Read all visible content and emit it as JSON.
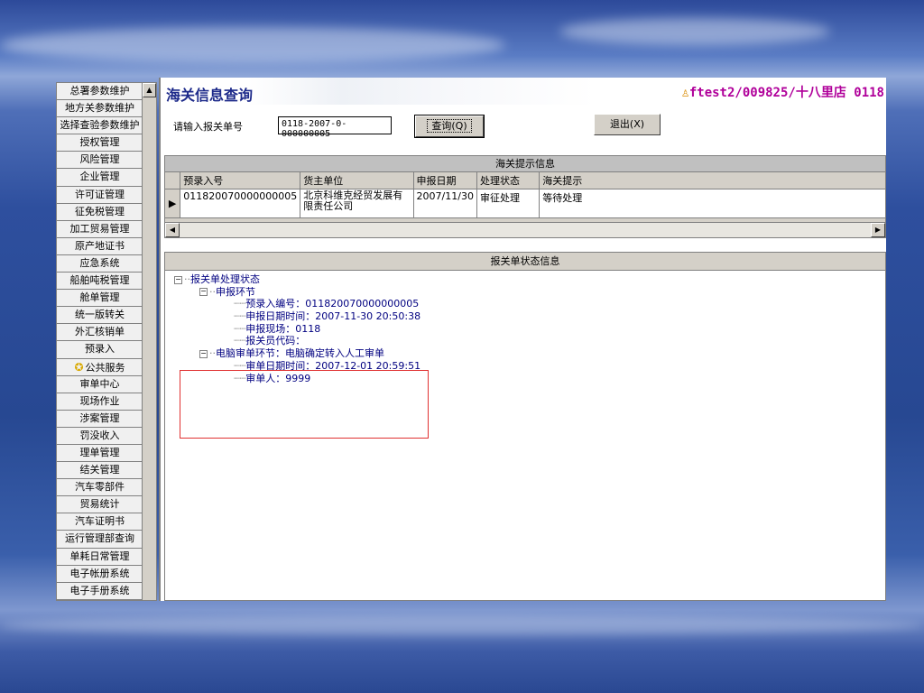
{
  "sidebar": {
    "items": [
      {
        "label": "总署参数维护"
      },
      {
        "label": "地方关参数维护"
      },
      {
        "label": "选择查验参数维护"
      },
      {
        "label": "授权管理"
      },
      {
        "label": "风险管理"
      },
      {
        "label": "企业管理"
      },
      {
        "label": "许可证管理"
      },
      {
        "label": "征免税管理"
      },
      {
        "label": "加工贸易管理"
      },
      {
        "label": "原产地证书"
      },
      {
        "label": "应急系统"
      },
      {
        "label": "船舶吨税管理"
      },
      {
        "label": "舱单管理"
      },
      {
        "label": "统一版转关"
      },
      {
        "label": "外汇核销单"
      },
      {
        "label": "预录入"
      },
      {
        "label": "公共服务",
        "icon": "star-icon"
      },
      {
        "label": "审单中心"
      },
      {
        "label": "现场作业"
      },
      {
        "label": "涉案管理"
      },
      {
        "label": "罚没收入"
      },
      {
        "label": "理单管理"
      },
      {
        "label": "结关管理"
      },
      {
        "label": "汽车零部件"
      },
      {
        "label": "贸易统计"
      },
      {
        "label": "汽车证明书"
      },
      {
        "label": "运行管理部查询"
      },
      {
        "label": "单耗日常管理"
      },
      {
        "label": "电子帐册系统"
      },
      {
        "label": "电子手册系统"
      }
    ]
  },
  "window": {
    "title": "海关信息查询",
    "user": "ftest2/009825/十八里店 0118"
  },
  "query": {
    "label": "请输入报关单号",
    "value": "0118-2007-0-000000005",
    "query_button": "查询(Q)",
    "exit_button": "退出(X)"
  },
  "grid": {
    "caption": "海关提示信息",
    "columns": [
      "预录入号",
      "货主单位",
      "申报日期",
      "处理状态",
      "海关提示"
    ],
    "rows": [
      [
        "011820070000000005",
        "北京科维克经贸发展有限责任公司",
        "2007/11/30",
        "审征处理",
        "等待处理"
      ]
    ]
  },
  "status": {
    "caption": "报关单状态信息",
    "tree": {
      "root": "报关单处理状态",
      "node1": "申报环节",
      "node1_children": [
        "预录入编号：011820070000000005",
        "申报日期时间：2007-11-30 20:50:38",
        "申报现场：0118",
        "报关员代码："
      ],
      "node2": "电脑审单环节：电脑确定转入人工审单",
      "node2_children": [
        "审单日期时间：2007-12-01 20:59:51",
        "审单人：9999"
      ]
    }
  },
  "colors": {
    "title": "#1d2a8a",
    "user": "#b0009a",
    "highlight": "#e03030"
  }
}
